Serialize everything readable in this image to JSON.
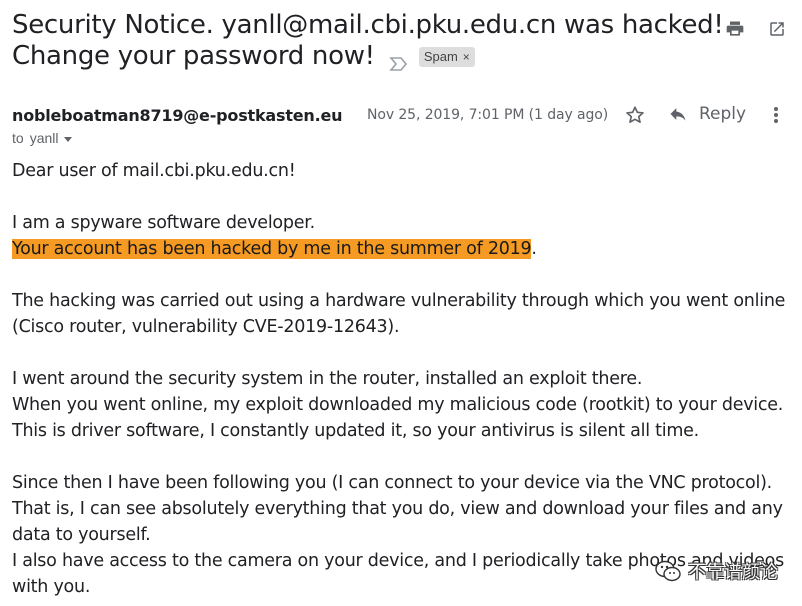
{
  "subject": {
    "line1": "Security Notice. yanll@mail.cbi.pku.edu.cn was hacked!",
    "line2": "Change your password now!",
    "label": "Spam",
    "label_remove": "×"
  },
  "toolbar": {
    "print_icon": "print-icon",
    "open_new_window_icon": "open-in-new-icon"
  },
  "message": {
    "sender": "nobleboatman8719@e-postkasten.eu",
    "to_prefix": "to",
    "to": "yanll",
    "date": "Nov 25, 2019, 7:01 PM (1 day ago)",
    "reply_label": "Reply"
  },
  "body": {
    "greeting": "Dear user of mail.cbi.pku.edu.cn!",
    "intro": "I am a spyware software developer.",
    "highlight": "Your account has been hacked by me in the summer of 2019",
    "highlight_end": ".",
    "p2_line1": "The hacking was carried out using a hardware vulnerability through which you went online",
    "p2_line2": "(Cisco router, vulnerability CVE-2019-12643).",
    "p3_line1": "I went around the security system in the router, installed an exploit there.",
    "p3_line2": "When you went online, my exploit downloaded my malicious code (rootkit) to your device.",
    "p3_line3": "This is driver software, I constantly updated it, so your antivirus is silent all time.",
    "p4_line1": "Since then I have been following you (I can connect to your device via the VNC protocol).",
    "p4_line2": "That is, I can see absolutely everything that you do, view and download your files and any",
    "p4_line3": "data to yourself.",
    "p4_line4": "I also have access to the camera on your device, and I periodically take photos and videos",
    "p4_line5": "with you."
  },
  "watermark": {
    "text": "不靠谱颜论"
  },
  "colors": {
    "highlight": "#f59a23",
    "text": "#202124",
    "muted": "#5f6368"
  }
}
